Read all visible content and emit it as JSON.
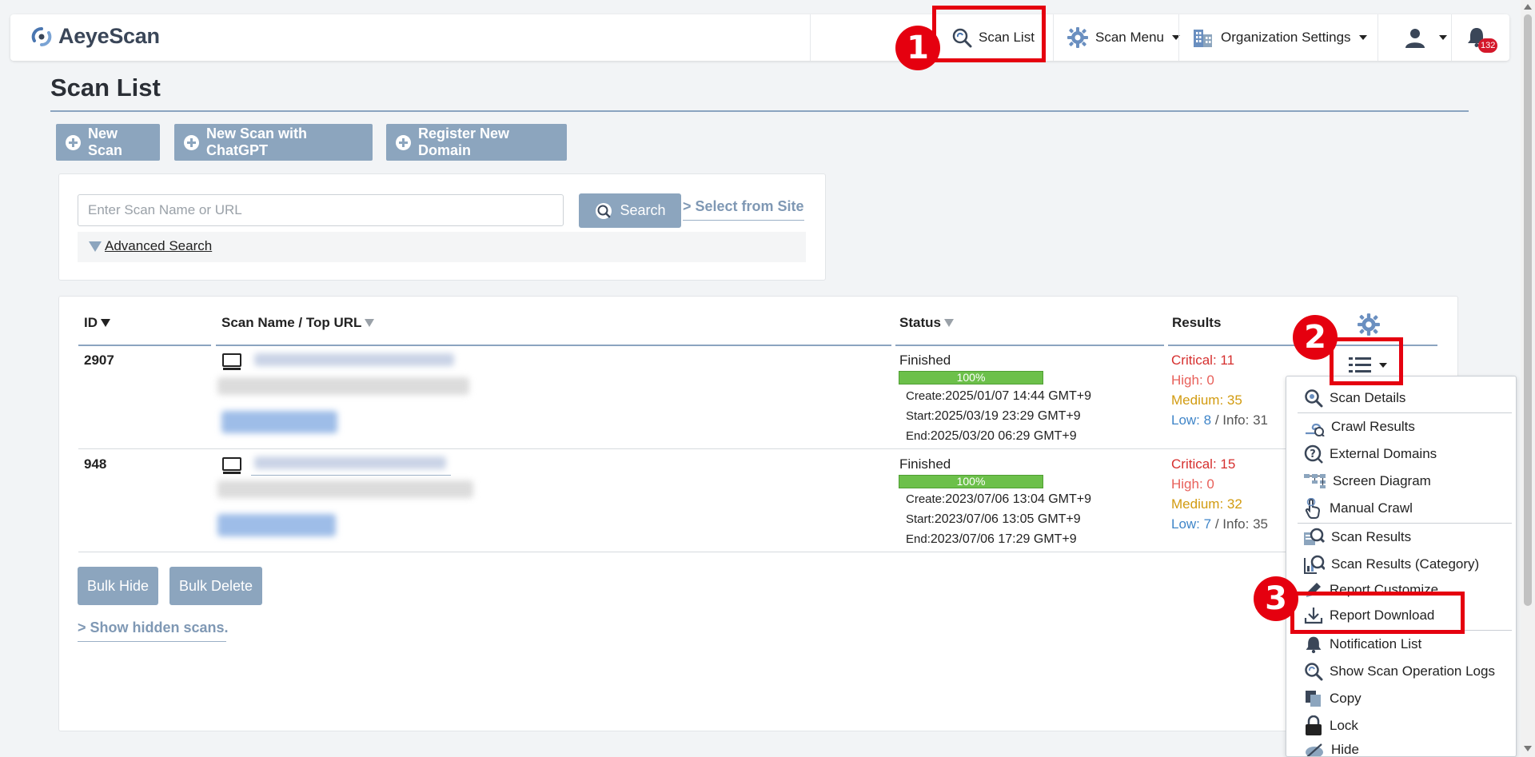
{
  "navbar": {
    "logo_text": "AeyeScan",
    "items": [
      {
        "label": "Scan List",
        "icon": "scan-search-icon"
      },
      {
        "label": "Scan Menu",
        "icon": "gear-icon"
      },
      {
        "label": "Organization Settings",
        "icon": "building-icon"
      },
      {
        "label": "",
        "icon": "user-icon"
      },
      {
        "label": "",
        "icon": "bell-icon"
      }
    ],
    "notification_count": "132"
  },
  "page": {
    "title": "Scan List"
  },
  "actions": {
    "new_scan": "New Scan",
    "new_scan_chatgpt": "New Scan with ChatGPT",
    "register_domain": "Register New Domain"
  },
  "search": {
    "placeholder": "Enter Scan Name or URL",
    "value": "",
    "button": "Search",
    "select_from_site": "Select from Site",
    "advanced": "Advanced Search"
  },
  "table": {
    "headers": {
      "id": "ID",
      "name": "Scan Name / Top URL",
      "status": "Status",
      "results": "Results"
    },
    "rows": [
      {
        "id": "2907",
        "status": "Finished",
        "progress_label": "100%",
        "progress": 1.0,
        "create": "2025/01/07 14:44 GMT+9",
        "start": "2025/03/19 23:29 GMT+9",
        "end": "2025/03/20 06:29 GMT+9",
        "critical": "Critical: 11",
        "high": "High: 0",
        "medium": "Medium: 35",
        "low": "Low: 8",
        "info": " / Info: 31"
      },
      {
        "id": "948",
        "status": "Finished",
        "progress_label": "100%",
        "progress": 1.0,
        "create": "2023/07/06 13:04 GMT+9",
        "start": "2023/07/06 13:05 GMT+9",
        "end": "2023/07/06 17:29 GMT+9",
        "critical": "Critical: 15",
        "high": "High: 0",
        "medium": "Medium: 32",
        "low": "Low: 7",
        "info": " / Info: 35"
      }
    ],
    "time_labels": {
      "create": "Create:",
      "start": "Start:",
      "end": "End:"
    }
  },
  "bulk": {
    "hide": "Bulk Hide",
    "delete": "Bulk Delete",
    "show_hidden": "Show hidden scans."
  },
  "dropdown": {
    "items": [
      {
        "label": "Scan Details",
        "icon": "scan-details-icon"
      },
      {
        "label": "Crawl Results",
        "icon": "crawl-icon"
      },
      {
        "label": "External Domains",
        "icon": "question-icon"
      },
      {
        "label": "Screen Diagram",
        "icon": "diagram-icon"
      },
      {
        "label": "Manual Crawl",
        "icon": "hand-pointer-icon"
      },
      {
        "label": "Scan Results",
        "icon": "scan-results-icon"
      },
      {
        "label": "Scan Results (Category)",
        "icon": "chart-search-icon"
      },
      {
        "label": "Report Customize",
        "icon": "pencil-icon"
      },
      {
        "label": "Report Download",
        "icon": "download-icon"
      },
      {
        "label": "Notification List",
        "icon": "bell-icon"
      },
      {
        "label": "Show Scan Operation Logs",
        "icon": "log-search-icon"
      },
      {
        "label": "Copy",
        "icon": "copy-icon"
      },
      {
        "label": "Lock",
        "icon": "lock-icon"
      },
      {
        "label": "Hide",
        "icon": "hide-icon"
      }
    ]
  },
  "annotations": [
    "1",
    "2",
    "3"
  ],
  "colors": {
    "accent": "#8ca5be",
    "annotation": "#e5000f",
    "critical": "#d6302f",
    "high": "#e8605a",
    "medium": "#d29b10",
    "low": "#3f85c8",
    "progress": "#6cc04a"
  }
}
